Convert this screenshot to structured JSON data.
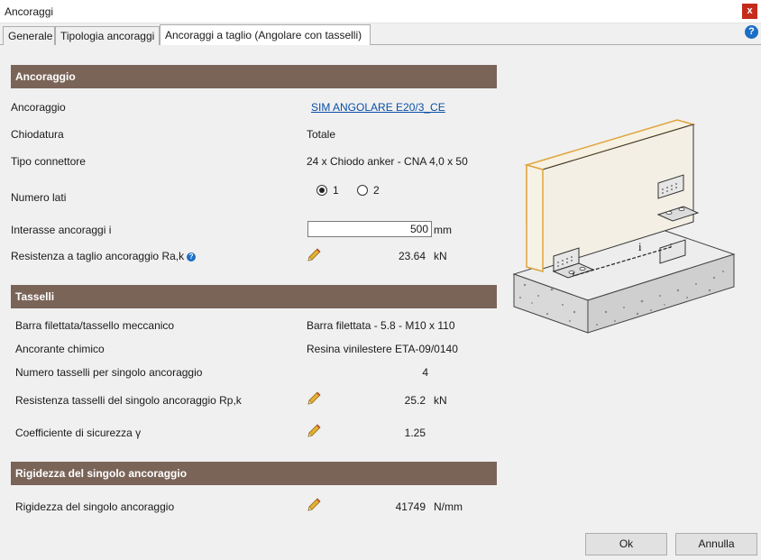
{
  "window": {
    "title": "Ancoraggi",
    "close_icon": "close-icon"
  },
  "tabs": [
    {
      "label": "Generale"
    },
    {
      "label": "Tipologia ancoraggi"
    },
    {
      "label": "Ancoraggi a taglio (Angolare con tasselli)"
    }
  ],
  "help_icon": "?",
  "sections": {
    "ancoraggio": {
      "title": "Ancoraggio",
      "ancoraggio_label": "Ancoraggio",
      "ancoraggio_value": "SIM ANGOLARE E20/3_CE",
      "chiodatura_label": "Chiodatura",
      "chiodatura_value": "Totale",
      "tipo_label": "Tipo connettore",
      "tipo_value": "24  x  Chiodo anker - CNA 4,0 x 50",
      "lati_label": "Numero lati",
      "lati_opt1": "1",
      "lati_opt2": "2",
      "lati_selected": "1",
      "interasse_label": "Interasse ancoraggi i",
      "interasse_value": "500",
      "interasse_unit": "mm",
      "resistenza_label": "Resistenza a taglio ancoraggio Ra,k",
      "resistenza_value": "23.64",
      "resistenza_unit": "kN"
    },
    "tasselli": {
      "title": "Tasselli",
      "barra_label": "Barra filettata/tassello meccanico",
      "barra_value": "Barra filettata - 5.8 - M10 x 110",
      "ancorante_label": "Ancorante chimico",
      "ancorante_value": "Resina vinilestere ETA-09/0140",
      "numero_label": "Numero tasselli per singolo ancoraggio",
      "numero_value": "4",
      "rp_label": "Resistenza tasselli del singolo ancoraggio Rp,k",
      "rp_value": "25.2",
      "rp_unit": "kN",
      "coeff_label": "Coefficiente di sicurezza γ",
      "coeff_value": "1.25"
    },
    "rigidezza": {
      "title": "Rigidezza del singolo ancoraggio",
      "label": "Rigidezza del singolo ancoraggio",
      "value": "41749",
      "unit": "N/mm"
    }
  },
  "figure": {
    "dimension_label": "i"
  },
  "buttons": {
    "ok": "Ok",
    "cancel": "Annulla"
  },
  "colors": {
    "section_header": "#7a6458",
    "accent_blue": "#1c6ec4",
    "close_red": "#c42b1c",
    "wood_edge": "#e0a43c"
  }
}
